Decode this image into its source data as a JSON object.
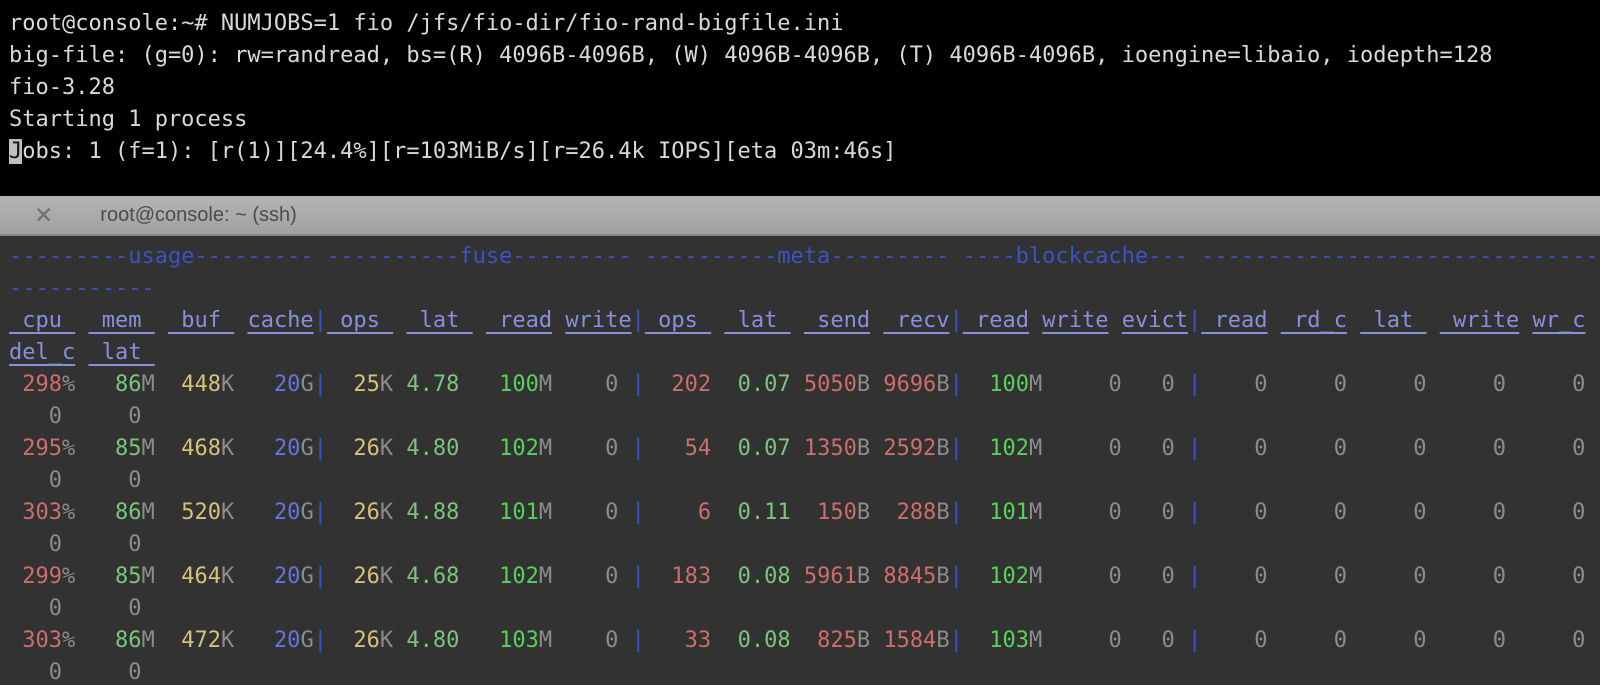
{
  "colors": {
    "terminal_bg": "#000000",
    "terminal_fg": "#d9d9d9",
    "stats_bg": "#323232",
    "tabbar_bg": "#a8a8a8",
    "section_blue": "#3d52c4",
    "header_periwinkle": "#8890dc",
    "value_red": "#cd6d6d",
    "value_green": "#7cc47c",
    "value_bright_green": "#57d157",
    "value_yellow": "#d2c377",
    "value_blue": "#6673d9",
    "unit_gray": "#8c8c8c"
  },
  "fio_terminal": {
    "lines": [
      "root@console:~# NUMJOBS=1 fio /jfs/fio-dir/fio-rand-bigfile.ini",
      "big-file: (g=0): rw=randread, bs=(R) 4096B-4096B, (W) 4096B-4096B, (T) 4096B-4096B, ioengine=libaio, iodepth=128",
      "fio-3.28",
      "Starting 1 process"
    ],
    "cursor_char": "J",
    "jobs_rest": "obs: 1 (f=1): [r(1)][24.4%][r=103MiB/s][r=26.4k IOPS][eta 03m:46s]"
  },
  "tab_bar": {
    "close_icon": "✕",
    "title": "root@console: ~ (ssh)"
  },
  "stats": {
    "sections_line": "---------usage--------- ----------fuse--------- ----------meta--------- ----blockcache--- ------------------------------",
    "sections_wrap": "-----------",
    "header_segments": [
      {
        "t": " cpu ",
        "c": "hdr"
      },
      {
        "t": " "
      },
      {
        "t": " mem ",
        "c": "hdr"
      },
      {
        "t": " "
      },
      {
        "t": " buf ",
        "c": "hdr"
      },
      {
        "t": " "
      },
      {
        "t": "cache",
        "c": "hdr"
      },
      {
        "t": "|",
        "c": "sep"
      },
      {
        "t": " ops ",
        "c": "hdr"
      },
      {
        "t": " "
      },
      {
        "t": " lat ",
        "c": "hdr"
      },
      {
        "t": " "
      },
      {
        "t": " read",
        "c": "hdr"
      },
      {
        "t": " "
      },
      {
        "t": "write",
        "c": "hdr"
      },
      {
        "t": "|",
        "c": "sep"
      },
      {
        "t": " ops ",
        "c": "hdr"
      },
      {
        "t": " "
      },
      {
        "t": " lat ",
        "c": "hdr"
      },
      {
        "t": " "
      },
      {
        "t": " send",
        "c": "hdr"
      },
      {
        "t": " "
      },
      {
        "t": " recv",
        "c": "hdr"
      },
      {
        "t": "|",
        "c": "sep"
      },
      {
        "t": " read",
        "c": "hdr"
      },
      {
        "t": " "
      },
      {
        "t": "write",
        "c": "hdr"
      },
      {
        "t": " "
      },
      {
        "t": "evict",
        "c": "hdr"
      },
      {
        "t": "|",
        "c": "sep"
      },
      {
        "t": " read",
        "c": "hdr"
      },
      {
        "t": " "
      },
      {
        "t": " rd_c",
        "c": "hdr"
      },
      {
        "t": " "
      },
      {
        "t": " lat ",
        "c": "hdr"
      },
      {
        "t": " "
      },
      {
        "t": " write",
        "c": "hdr"
      },
      {
        "t": " "
      },
      {
        "t": "wr_c",
        "c": "hdr"
      }
    ],
    "header_wrap_segments": [
      {
        "t": "del_c",
        "c": "hdr"
      },
      {
        "t": " "
      },
      {
        "t": " lat ",
        "c": "hdr"
      }
    ],
    "rows": [
      {
        "cpu": "298",
        "mem": "86",
        "buf": "448",
        "cache": "20",
        "fops": "25",
        "flat": "4.78",
        "fread": "100",
        "fwrite": "0",
        "mops": "202",
        "mlat": "0.07",
        "send": "5050",
        "recv": "9696",
        "bread": "100",
        "bwrite": "0",
        "evict": "0",
        "oread": "0",
        "rdc": "0",
        "olat": "0",
        "owrite": "0",
        "wrc": "0",
        "delc": "0",
        "dlat": "0"
      },
      {
        "cpu": "295",
        "mem": "85",
        "buf": "468",
        "cache": "20",
        "fops": "26",
        "flat": "4.80",
        "fread": "102",
        "fwrite": "0",
        "mops": "54",
        "mlat": "0.07",
        "send": "1350",
        "recv": "2592",
        "bread": "102",
        "bwrite": "0",
        "evict": "0",
        "oread": "0",
        "rdc": "0",
        "olat": "0",
        "owrite": "0",
        "wrc": "0",
        "delc": "0",
        "dlat": "0"
      },
      {
        "cpu": "303",
        "mem": "86",
        "buf": "520",
        "cache": "20",
        "fops": "26",
        "flat": "4.88",
        "fread": "101",
        "fwrite": "0",
        "mops": "6",
        "mlat": "0.11",
        "send": "150",
        "recv": "288",
        "bread": "101",
        "bwrite": "0",
        "evict": "0",
        "oread": "0",
        "rdc": "0",
        "olat": "0",
        "owrite": "0",
        "wrc": "0",
        "delc": "0",
        "dlat": "0"
      },
      {
        "cpu": "299",
        "mem": "85",
        "buf": "464",
        "cache": "20",
        "fops": "26",
        "flat": "4.68",
        "fread": "102",
        "fwrite": "0",
        "mops": "183",
        "mlat": "0.08",
        "send": "5961",
        "recv": "8845",
        "bread": "102",
        "bwrite": "0",
        "evict": "0",
        "oread": "0",
        "rdc": "0",
        "olat": "0",
        "owrite": "0",
        "wrc": "0",
        "delc": "0",
        "dlat": "0"
      },
      {
        "cpu": "303",
        "mem": "86",
        "buf": "472",
        "cache": "20",
        "fops": "26",
        "flat": "4.80",
        "fread": "103",
        "fwrite": "0",
        "mops": "33",
        "mlat": "0.08",
        "send": "825",
        "recv": "1584",
        "bread": "103",
        "bwrite": "0",
        "evict": "0",
        "oread": "0",
        "rdc": "0",
        "olat": "0",
        "owrite": "0",
        "wrc": "0",
        "delc": "0",
        "dlat": "0"
      }
    ]
  }
}
